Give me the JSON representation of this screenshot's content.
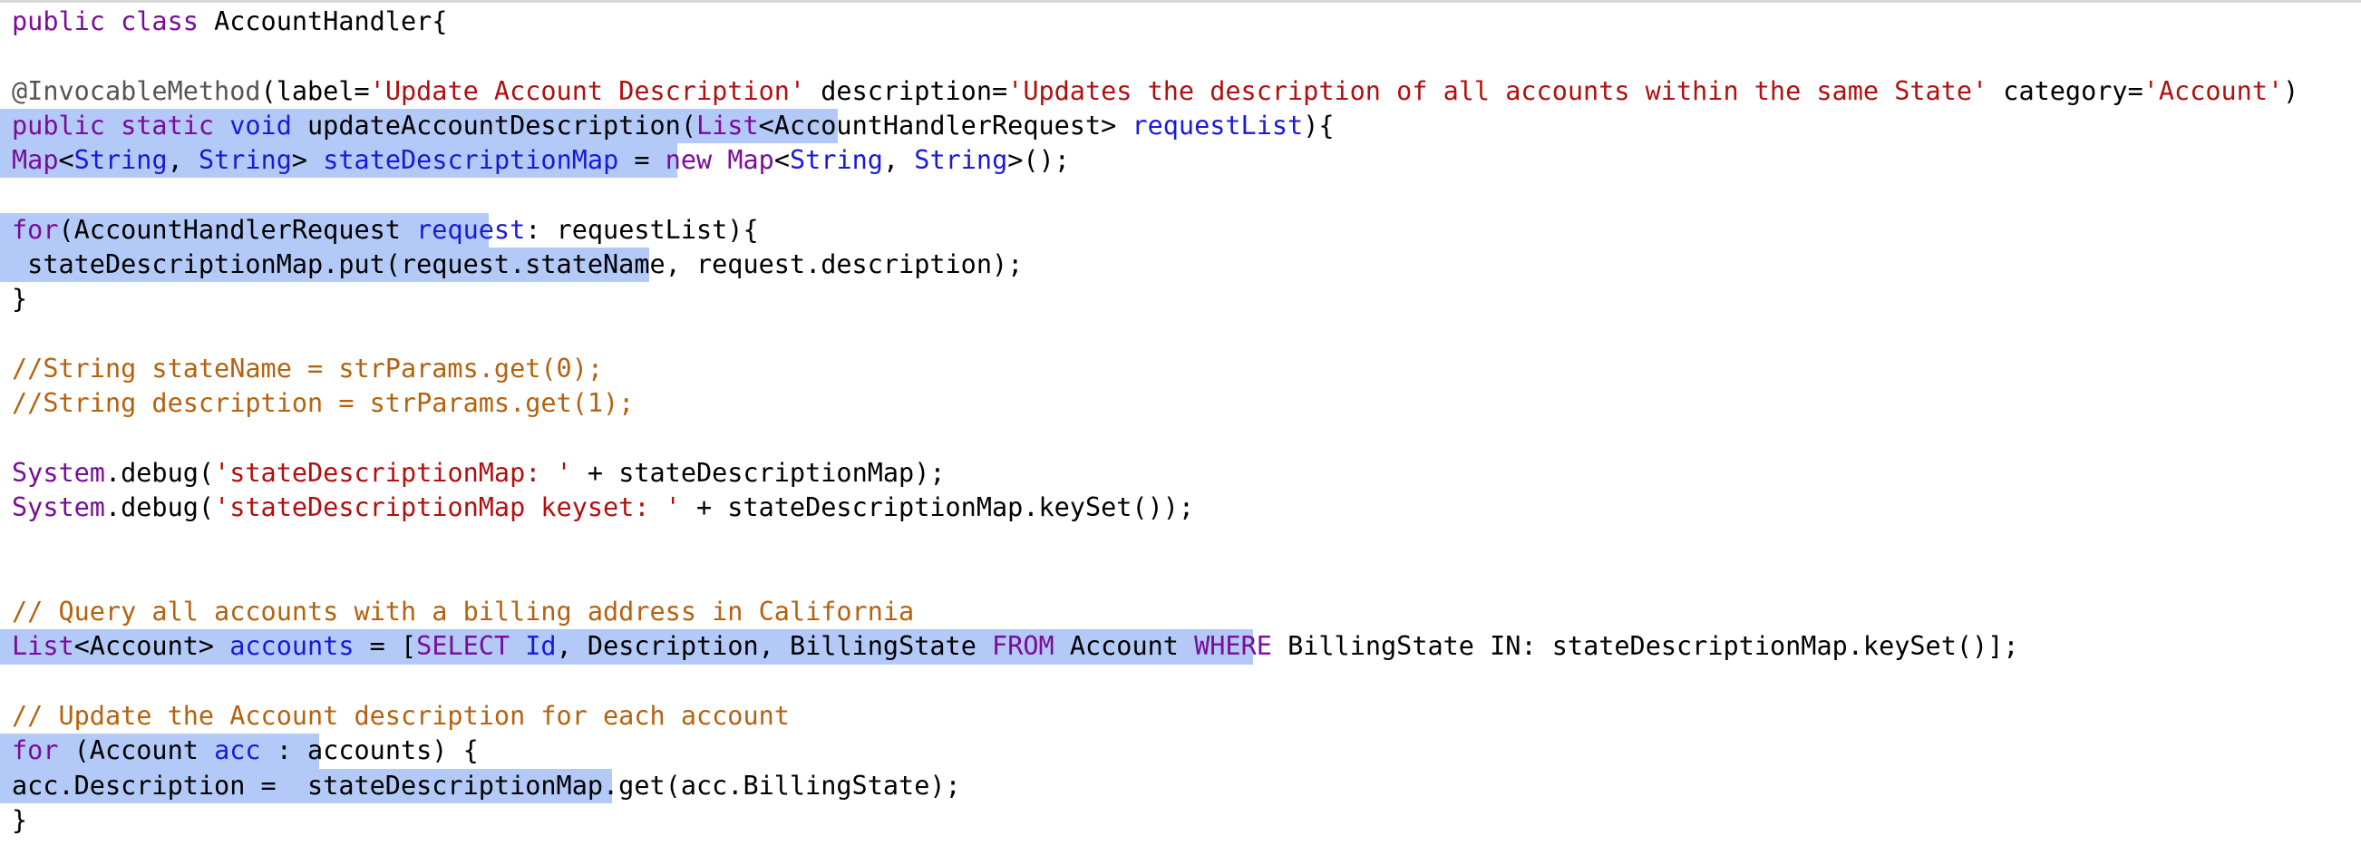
{
  "editor": {
    "lines": [
      {
        "segments": [
          {
            "t": "public class ",
            "c": "kw"
          },
          {
            "t": "AccountHandler{",
            "c": "plain"
          }
        ]
      },
      {
        "segments": []
      },
      {
        "segments": [
          {
            "t": "@InvocableMethod",
            "c": "ann"
          },
          {
            "t": "(label=",
            "c": "plain"
          },
          {
            "t": "'Update Account Description'",
            "c": "str"
          },
          {
            "t": " description=",
            "c": "plain"
          },
          {
            "t": "'Updates the description of all accounts within the same State'",
            "c": "str"
          },
          {
            "t": " category=",
            "c": "plain"
          },
          {
            "t": "'Account'",
            "c": "str"
          },
          {
            "t": ")",
            "c": "plain"
          }
        ]
      },
      {
        "sel": 924,
        "segments": [
          {
            "t": "public static ",
            "c": "kw"
          },
          {
            "t": "void ",
            "c": "type"
          },
          {
            "t": "updateAccountDescription(",
            "c": "plain"
          },
          {
            "t": "List",
            "c": "kw"
          },
          {
            "t": "<AccountHandlerRequest> ",
            "c": "plain"
          },
          {
            "t": "requestList",
            "c": "type"
          },
          {
            "t": "){",
            "c": "plain"
          }
        ]
      },
      {
        "sel": 747,
        "segments": [
          {
            "t": "Map",
            "c": "kw"
          },
          {
            "t": "<",
            "c": "plain"
          },
          {
            "t": "String",
            "c": "type"
          },
          {
            "t": ", ",
            "c": "plain"
          },
          {
            "t": "String",
            "c": "type"
          },
          {
            "t": "> ",
            "c": "plain"
          },
          {
            "t": "stateDescriptionMap",
            "c": "type"
          },
          {
            "t": " = ",
            "c": "plain"
          },
          {
            "t": "new ",
            "c": "kw"
          },
          {
            "t": "Map",
            "c": "kw"
          },
          {
            "t": "<",
            "c": "plain"
          },
          {
            "t": "String",
            "c": "type"
          },
          {
            "t": ", ",
            "c": "plain"
          },
          {
            "t": "String",
            "c": "type"
          },
          {
            "t": ">();",
            "c": "plain"
          }
        ]
      },
      {
        "segments": []
      },
      {
        "sel": 539,
        "segments": [
          {
            "t": "for",
            "c": "kw"
          },
          {
            "t": "(AccountHandlerRequest ",
            "c": "plain"
          },
          {
            "t": "request",
            "c": "type"
          },
          {
            "t": ": requestList){",
            "c": "plain"
          }
        ]
      },
      {
        "sel": 716,
        "segments": [
          {
            "t": " stateDescriptionMap.put(request.stateName, request.description);",
            "c": "plain"
          }
        ]
      },
      {
        "segments": [
          {
            "t": "}",
            "c": "plain"
          }
        ]
      },
      {
        "segments": []
      },
      {
        "segments": [
          {
            "t": "//String stateName = strParams.get(0);",
            "c": "cmt"
          }
        ]
      },
      {
        "segments": [
          {
            "t": "//String description = strParams.get(1);",
            "c": "cmt"
          }
        ]
      },
      {
        "segments": []
      },
      {
        "segments": [
          {
            "t": "System",
            "c": "kw"
          },
          {
            "t": ".debug(",
            "c": "plain"
          },
          {
            "t": "'stateDescriptionMap: '",
            "c": "str"
          },
          {
            "t": " + stateDescriptionMap);",
            "c": "plain"
          }
        ]
      },
      {
        "segments": [
          {
            "t": "System",
            "c": "kw"
          },
          {
            "t": ".debug(",
            "c": "plain"
          },
          {
            "t": "'stateDescriptionMap keyset: '",
            "c": "str"
          },
          {
            "t": " + stateDescriptionMap.keySet());",
            "c": "plain"
          }
        ]
      },
      {
        "segments": []
      },
      {
        "segments": []
      },
      {
        "segments": [
          {
            "t": "// Query all accounts with a billing address in California",
            "c": "cmt"
          }
        ]
      },
      {
        "sel": 1382,
        "segments": [
          {
            "t": "List",
            "c": "kw"
          },
          {
            "t": "<Account> ",
            "c": "plain"
          },
          {
            "t": "accounts",
            "c": "type"
          },
          {
            "t": " = [",
            "c": "plain"
          },
          {
            "t": "SELECT ",
            "c": "kw"
          },
          {
            "t": "Id",
            "c": "type"
          },
          {
            "t": ", Description, BillingState ",
            "c": "plain"
          },
          {
            "t": "FROM ",
            "c": "kw"
          },
          {
            "t": "Account ",
            "c": "plain"
          },
          {
            "t": "WHERE ",
            "c": "kw"
          },
          {
            "t": "BillingState IN: stateDescriptionMap.keySet()];",
            "c": "plain"
          }
        ]
      },
      {
        "segments": []
      },
      {
        "segments": [
          {
            "t": "// Update the Account description for each account",
            "c": "cmt"
          }
        ]
      },
      {
        "sel": 352,
        "segments": [
          {
            "t": "for ",
            "c": "kw"
          },
          {
            "t": "(Account ",
            "c": "plain"
          },
          {
            "t": "acc",
            "c": "type"
          },
          {
            "t": " : accounts) {",
            "c": "plain"
          }
        ]
      },
      {
        "sel": 675,
        "segments": [
          {
            "t": "acc.Description =  stateDescriptionMap.get(acc.BillingState);",
            "c": "plain"
          }
        ]
      },
      {
        "segments": [
          {
            "t": "}",
            "c": "plain"
          }
        ]
      }
    ]
  }
}
